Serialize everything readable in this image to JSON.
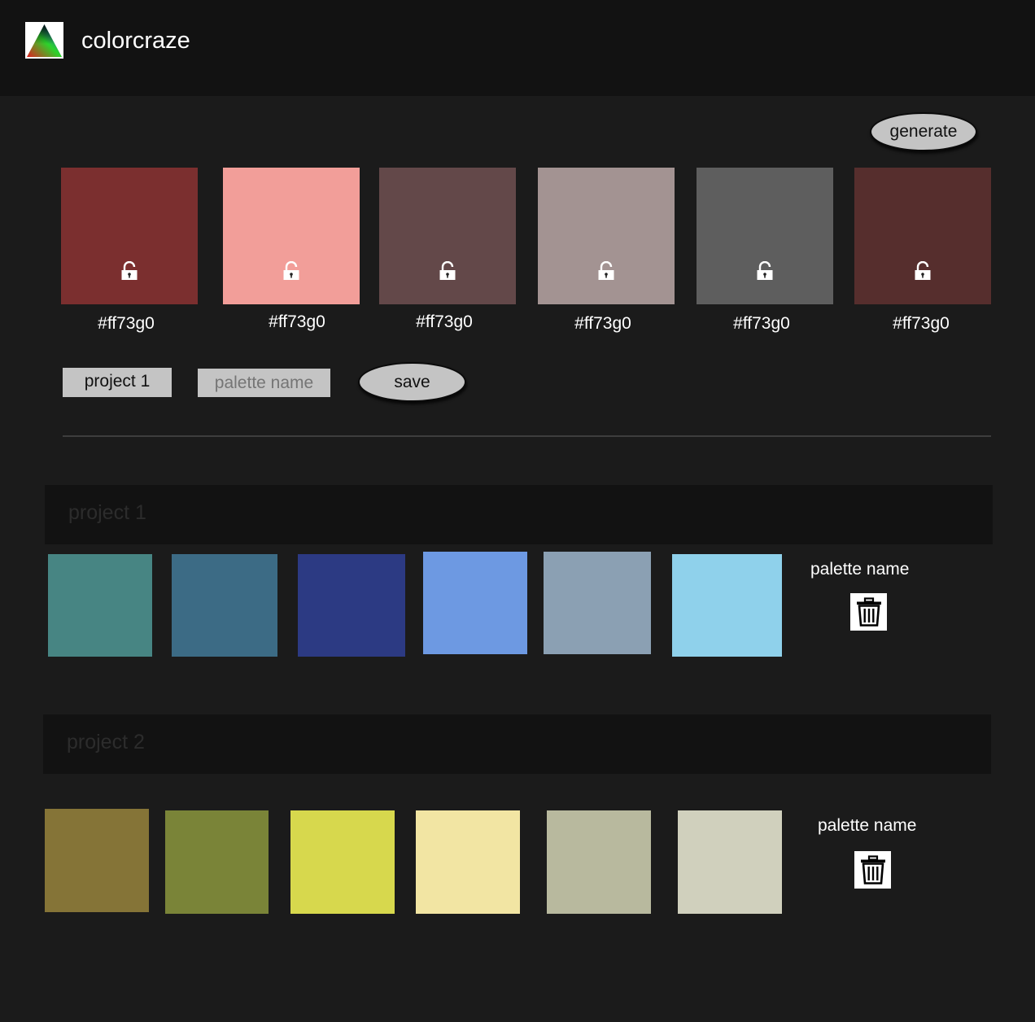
{
  "app": {
    "title": "colorcraze"
  },
  "generator": {
    "generate_label": "generate",
    "swatches": [
      {
        "color": "#7b2f2f",
        "hex": "#ff73g0"
      },
      {
        "color": "#f29e99",
        "hex": "#ff73g0"
      },
      {
        "color": "#634849",
        "hex": "#ff73g0"
      },
      {
        "color": "#a39392",
        "hex": "#ff73g0"
      },
      {
        "color": "#5e5e5e",
        "hex": "#ff73g0"
      },
      {
        "color": "#562e2d",
        "hex": "#ff73g0"
      }
    ],
    "project_select": "project 1",
    "palette_name_input": "palette name",
    "save_label": "save"
  },
  "projects": [
    {
      "title": "project 1",
      "palette_name": "palette name",
      "colors": [
        "#478583",
        "#3c6b85",
        "#2c3a83",
        "#6d99e2",
        "#8ba0b3",
        "#8fd1eb"
      ]
    },
    {
      "title": "project 2",
      "palette_name": "palette name",
      "colors": [
        "#857437",
        "#7a8438",
        "#d7d84d",
        "#f2e5a3",
        "#b8b99e",
        "#d0d0bd"
      ]
    }
  ]
}
